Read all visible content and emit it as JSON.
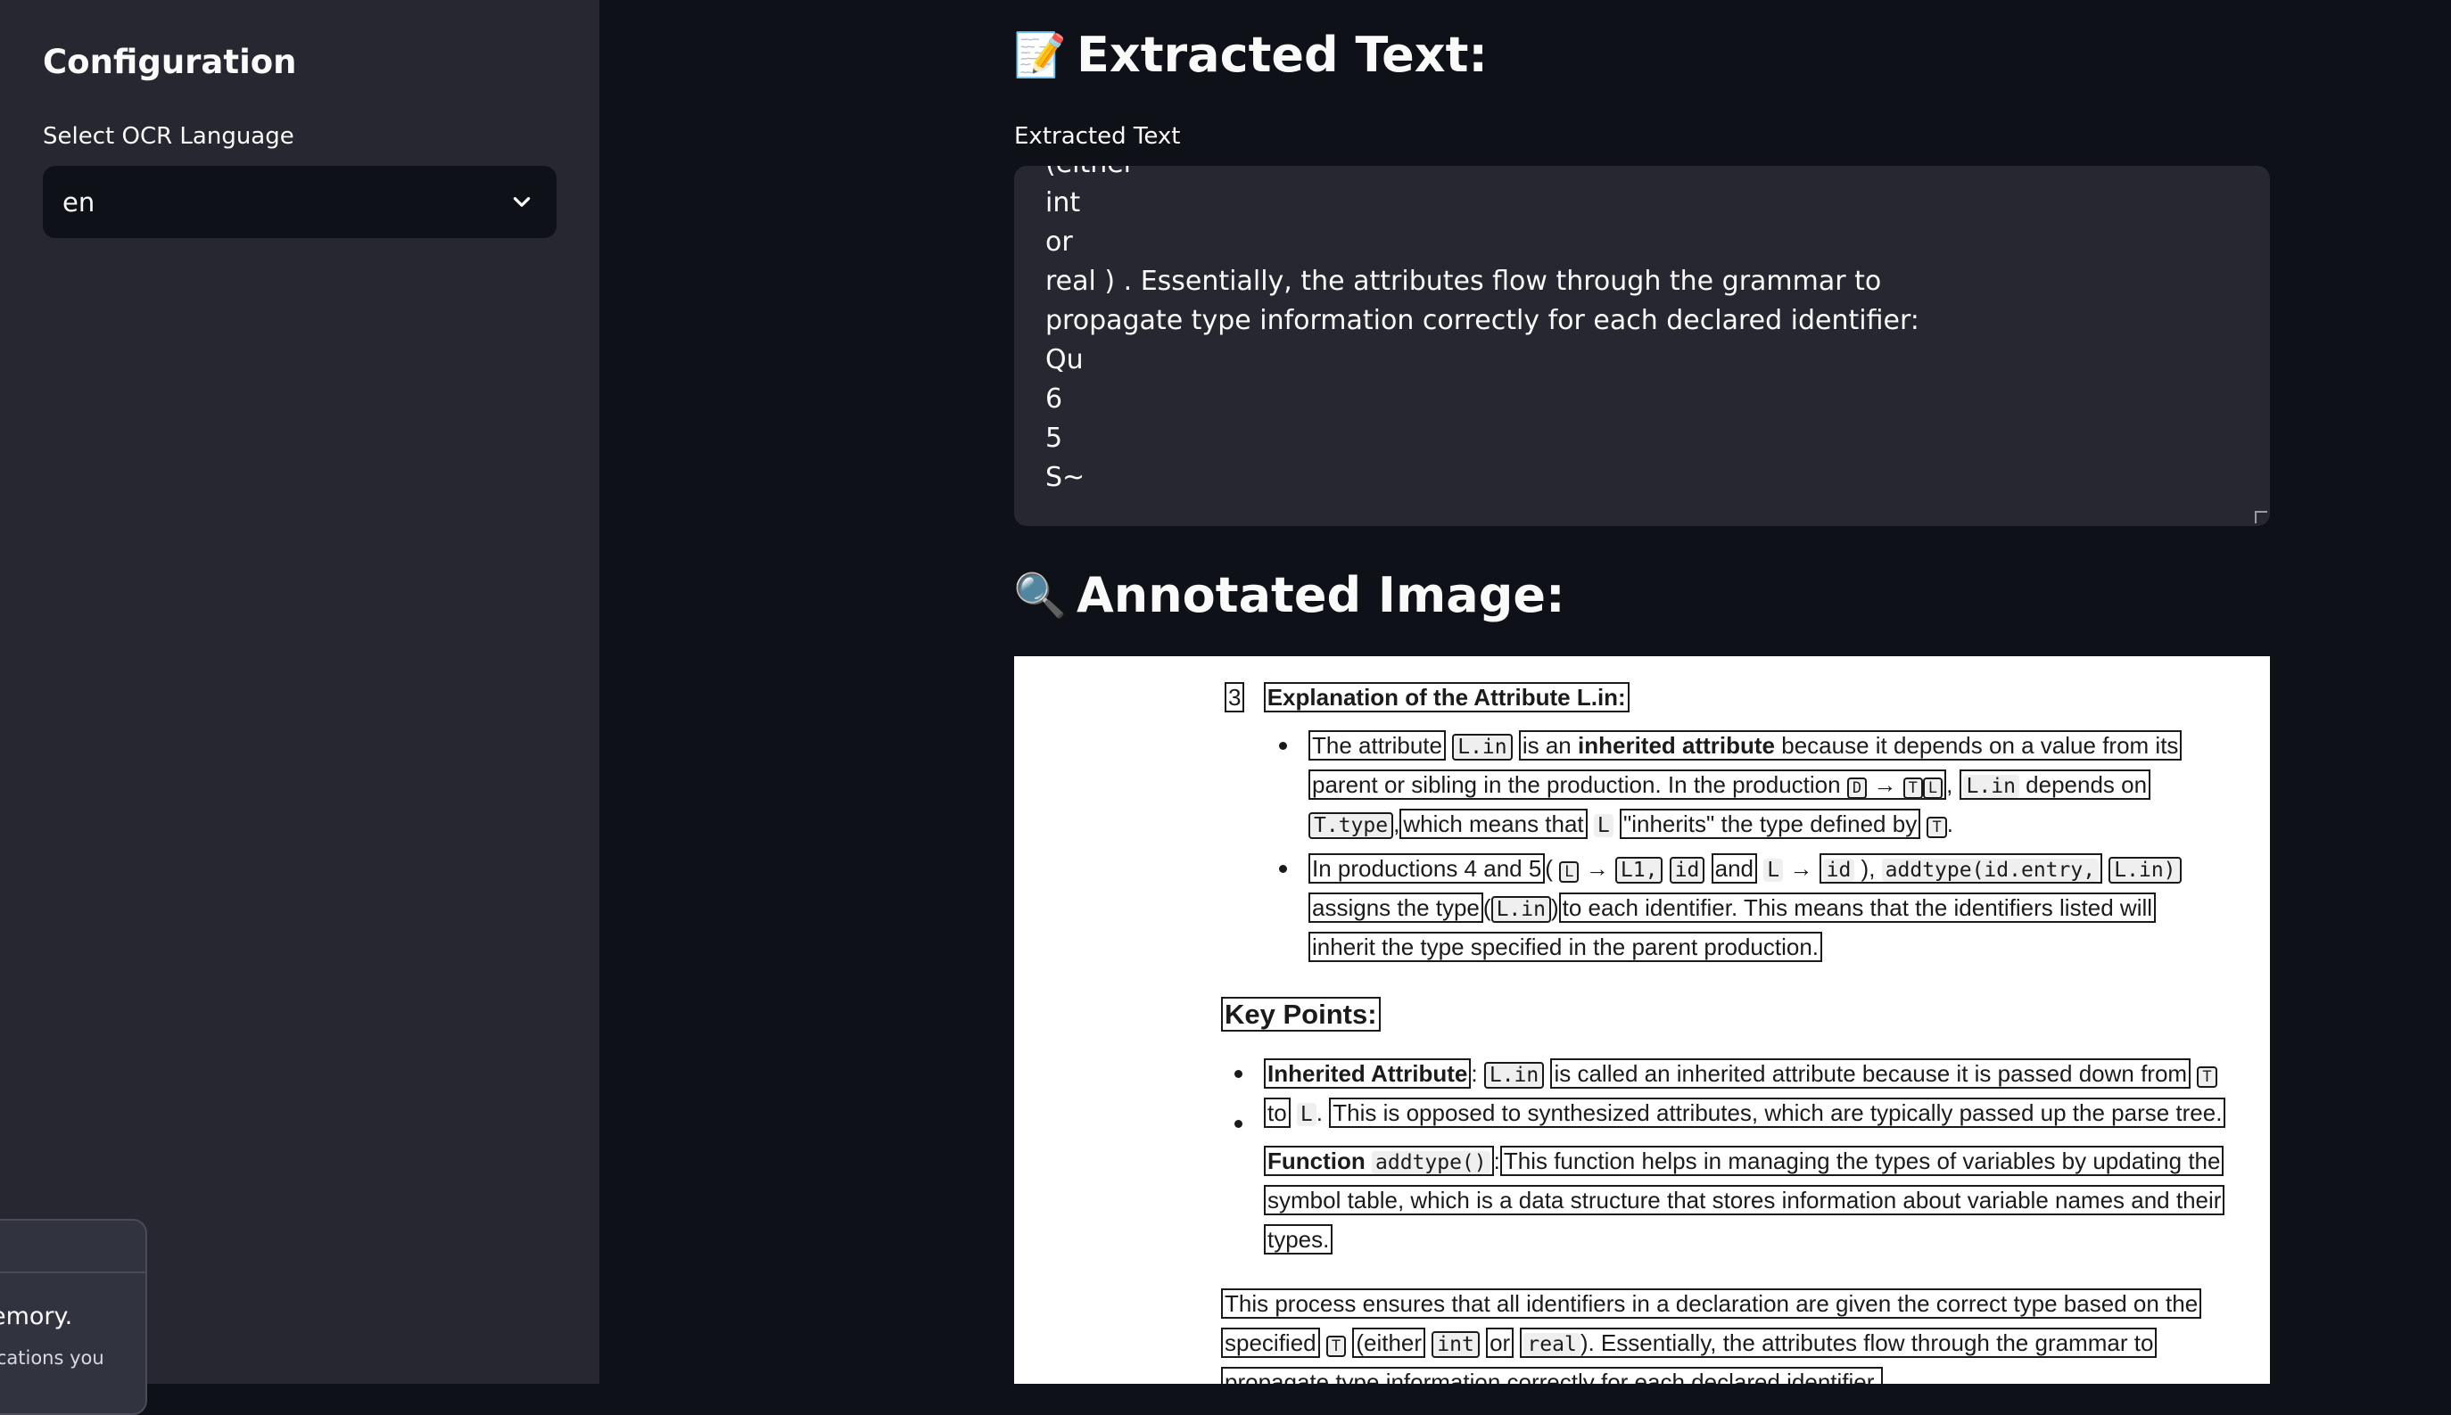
{
  "sidebar": {
    "title": "Configuration",
    "select_label": "Select OCR Language",
    "select_value": "en"
  },
  "toast": {
    "line1": "emory.",
    "line2": "ications you"
  },
  "main": {
    "extracted_heading": "Extracted Text:",
    "extracted_emoji": "📝",
    "field_label": "Extracted Text",
    "text_lines": [
      "(either",
      "int",
      "or",
      "real ) . Essentially, the attributes flow through the grammar to",
      "propagate type information correctly for each declared identifier:",
      "Qu",
      "6",
      "5",
      "S~"
    ],
    "annotated_heading": "Annotated Image:",
    "annotated_emoji": "🔍"
  },
  "annotated": {
    "section_num": "3",
    "section_title": "Explanation of the Attribute L.in:",
    "b1": {
      "p1": "The attribute",
      "c1": "L.in",
      "p2": "is an",
      "bold": "inherited attribute",
      "p3": "because it depends on a value from its",
      "l2a": "parent or sibling in the production. In the production",
      "sym_d": "D",
      "arrow": "→",
      "sym_t": "T",
      "sym_l": "L",
      "comma": ",",
      "c2": "L.in",
      "l2b": "depends on",
      "c3": "T.type",
      "l3a": "which means that",
      "c4": "L",
      "l3b": "\"inherits\" the type defined by",
      "sym_t2": "T",
      "dot": "."
    },
    "b2": {
      "l1a": "In productions 4 and 5",
      "paren": "(",
      "c1": "L",
      "c2": "L1,",
      "c3": "id",
      "and": "and",
      "c4": "L",
      "c5": "id",
      "paren2": "),",
      "c6": "addtype(id.entry,",
      "c7": "L.in)",
      "l2a": "assigns the type",
      "c8": "L.in",
      "l2b": "to each identifier. This means that the identifiers listed will",
      "l3": "inherit the type specified in the parent production."
    },
    "key_points_title": "Key Points:",
    "k1": {
      "bold": "Inherited Attribute",
      "colon": ":",
      "c1": "L.in",
      "l1": "is called an inherited attribute because it is passed down from",
      "sym": "T",
      "to": "to",
      "c2": "L",
      "l2": "This is opposed to synthesized attributes, which are typically passed up the parse tree."
    },
    "k2": {
      "bold": "Function",
      "c1": "addtype()",
      "colon": ":",
      "l1": "This function helps in managing the types of variables by updating the",
      "l2": "symbol table, which is a data structure that stores information about variable names and their",
      "l3": "types."
    },
    "para": {
      "l1": "This process ensures that all identifiers in a declaration are given the correct type based on the",
      "l2a": "specified",
      "sym": "T",
      "l2b": "(either",
      "c1": "int",
      "or": "or",
      "c2": "real",
      "l2c": "). Essentially, the attributes flow through the grammar to",
      "l3": "propagate type information correctly for each declared identifier."
    }
  }
}
